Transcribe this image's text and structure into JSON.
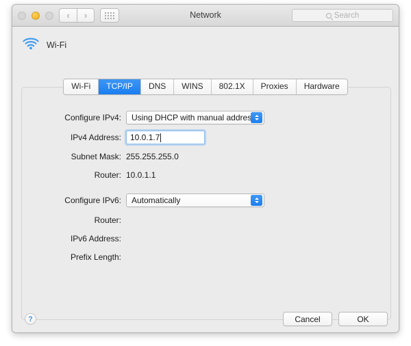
{
  "window": {
    "title": "Network",
    "traffic_lights": [
      {
        "name": "close",
        "state": "inactive"
      },
      {
        "name": "minimize",
        "state": "amber"
      },
      {
        "name": "zoom",
        "state": "inactive"
      }
    ],
    "nav": {
      "back": "‹",
      "forward": "›"
    },
    "show_all_icon": "grid-icon",
    "search": {
      "placeholder": "Search",
      "value": ""
    }
  },
  "service": {
    "icon": "wifi-icon",
    "name": "Wi-Fi"
  },
  "tabs": [
    {
      "label": "Wi-Fi",
      "active": false
    },
    {
      "label": "TCP/IP",
      "active": true
    },
    {
      "label": "DNS",
      "active": false
    },
    {
      "label": "WINS",
      "active": false
    },
    {
      "label": "802.1X",
      "active": false
    },
    {
      "label": "Proxies",
      "active": false
    },
    {
      "label": "Hardware",
      "active": false
    }
  ],
  "ipv4": {
    "configure_label": "Configure IPv4:",
    "configure_value": "Using DHCP with manual address",
    "address_label": "IPv4 Address:",
    "address_value": "10.0.1.7",
    "subnet_label": "Subnet Mask:",
    "subnet_value": "255.255.255.0",
    "router_label": "Router:",
    "router_value": "10.0.1.1"
  },
  "ipv6": {
    "configure_label": "Configure IPv6:",
    "configure_value": "Automatically",
    "router_label": "Router:",
    "router_value": "",
    "address_label": "IPv6 Address:",
    "address_value": "",
    "prefix_label": "Prefix Length:",
    "prefix_value": ""
  },
  "footer": {
    "help_label": "?",
    "cancel_label": "Cancel",
    "ok_label": "OK"
  },
  "colors": {
    "accent_blue": "#1a7ef0",
    "wifi_blue": "#3d9bf0",
    "amber": "#f7bc33",
    "window_bg": "#ececec",
    "panel_bg": "#ebebeb"
  }
}
